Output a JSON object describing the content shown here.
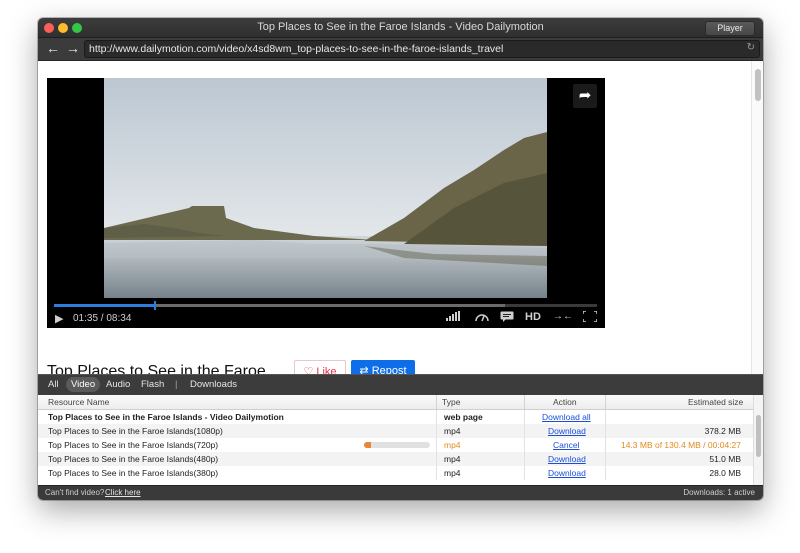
{
  "window": {
    "title": "Top Places to See in the Faroe Islands - Video Dailymotion",
    "player_button": "Player"
  },
  "toolbar": {
    "back_icon": "arrow-left",
    "forward_icon": "arrow-right",
    "url": "http://www.dailymotion.com/video/x4sd8wm_top-places-to-see-in-the-faroe-islands_travel",
    "reload_icon": "reload"
  },
  "player": {
    "current_time": "01:35",
    "duration": "08:34",
    "time_display": "01:35 / 08:34",
    "progress_fraction": 0.185,
    "buffered_fraction": 0.83,
    "hd_label": "HD",
    "controls": [
      "volume-icon",
      "speed-icon",
      "captions-icon",
      "HD",
      "widescreen-icon",
      "fullscreen-icon"
    ]
  },
  "page": {
    "video_title": "Top Places to See in the Faroe Islands",
    "like_label": "Like",
    "repost_label": "Repost"
  },
  "downloader": {
    "filters": [
      "All",
      "Video",
      "Audio",
      "Flash",
      "|",
      "Downloads"
    ],
    "active_filter": "Video",
    "columns": [
      "Resource Name",
      "Type",
      "Action",
      "Estimated size"
    ],
    "rows": [
      {
        "name": "Top Places to See in the Faroe Islands - Video Dailymotion",
        "type": "web page",
        "action": "Download all",
        "size": ""
      },
      {
        "name": "Top Places to See in the Faroe Islands(1080p)",
        "type": "mp4",
        "action": "Download",
        "size": "378.2 MB"
      },
      {
        "name": "Top Places to See in the Faroe Islands(720p)",
        "type": "mp4",
        "action": "Cancel",
        "size": "14.3 MB of 130.4 MB / 00:04:27",
        "progress": 0.11
      },
      {
        "name": "Top Places to See in the Faroe Islands(480p)",
        "type": "mp4",
        "action": "Download",
        "size": "51.0 MB"
      },
      {
        "name": "Top Places to See in the Faroe Islands(380p)",
        "type": "mp4",
        "action": "Download",
        "size": "28.0 MB"
      }
    ],
    "status_left": "Can't find video?",
    "status_link": "Click here",
    "status_right": "Downloads: 1 active"
  }
}
